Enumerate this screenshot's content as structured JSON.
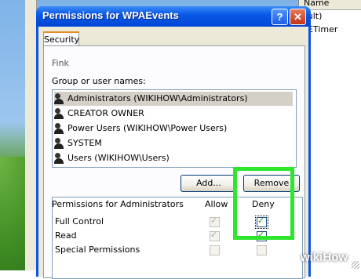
{
  "dialog": {
    "title": "Permissions for WPAEvents",
    "help_glyph": "?",
    "close_glyph": "✕"
  },
  "tabs": [
    {
      "label": "Security"
    }
  ],
  "group_section": {
    "label": "Group or user names:",
    "items": [
      {
        "label": "Administrators (WIKIHOW\\Administrators)",
        "icon": "user-group-icon",
        "selected": true
      },
      {
        "label": "CREATOR OWNER",
        "icon": "user-group-icon"
      },
      {
        "label": "Power Users (WIKIHOW\\Power Users)",
        "icon": "user-group-icon"
      },
      {
        "label": "SYSTEM",
        "icon": "user-group-icon"
      },
      {
        "label": "Users (WIKIHOW\\Users)",
        "icon": "user-group-icon"
      }
    ]
  },
  "buttons": {
    "add": "Add...",
    "remove": "Remove"
  },
  "permissions": {
    "label": "Permissions for Administrators",
    "allow_header": "Allow",
    "deny_header": "Deny",
    "rows": [
      {
        "name": "Full Control",
        "allow": true,
        "deny": true
      },
      {
        "name": "Read",
        "allow": true,
        "deny": true
      },
      {
        "name": "Special Permissions",
        "allow": false,
        "deny": false
      }
    ]
  },
  "background_window": {
    "column": "Name",
    "rows": [
      "ault)",
      "SETimer"
    ]
  },
  "partial_tab_text": "Fink",
  "watermark": {
    "prefix": "wiki",
    "suffix": "How"
  },
  "colors": {
    "highlight": "#2ee62e",
    "titlebar": "#0a55e0"
  }
}
